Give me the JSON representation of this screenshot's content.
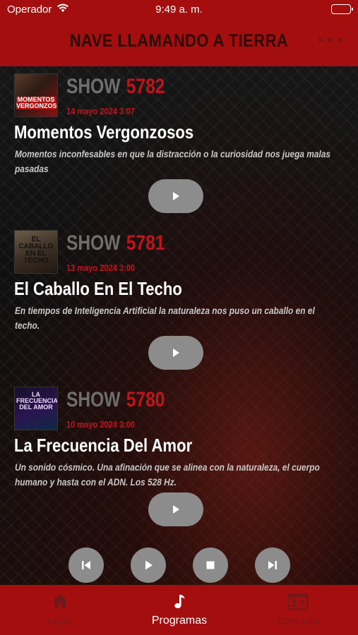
{
  "status": {
    "carrier": "Operador",
    "time": "9:49 a. m."
  },
  "header": {
    "title": "NAVE LLAMANDO A TIERRA",
    "more_label": "•••"
  },
  "episodes": [
    {
      "show_word": "SHOW",
      "number": "5782",
      "date": "14 mayo 2024 3:07",
      "title": "Momentos Vergonzosos",
      "description": "Momentos inconfesables en que la distracción o la curiosidad nos juega malas pasadas",
      "thumb_text": "MOMENTOS VERGONZOSOS"
    },
    {
      "show_word": "SHOW",
      "number": "5781",
      "date": "13 mayo 2024 3:00",
      "title": "El Caballo En El Techo",
      "description": "En tiempos de Inteligencia Artificial la naturaleza nos puso un caballo en el techo.",
      "thumb_text": "EL CABALLO EN EL TECHO"
    },
    {
      "show_word": "SHOW",
      "number": "5780",
      "date": "10 mayo 2024 3:00",
      "title": "La Frecuencia Del Amor",
      "description": "Un sonido cósmico. Una afinación que se alinea con la naturaleza, el cuerpo humano y hasta con el ADN. Los 528 Hz.",
      "thumb_text": "LA FRECUENCIA DEL AMOR"
    }
  ],
  "tabs": [
    {
      "label": "Inicio",
      "icon": "home-icon",
      "active": false
    },
    {
      "label": "Programas",
      "icon": "music-note-icon",
      "active": true
    },
    {
      "label": "Contacto",
      "icon": "contact-card-icon",
      "active": false
    }
  ],
  "colors": {
    "brand_red": "#a50e0e",
    "accent_red": "#c0141a",
    "button_gray": "#8c8c8c"
  }
}
